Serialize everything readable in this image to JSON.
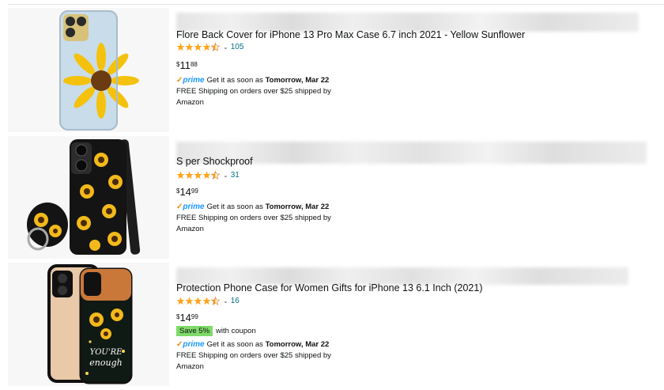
{
  "products": [
    {
      "title_visible": "Flore                  Back Cover for iPhone 13 Pro Max Case 6.7 inch 2021 - Yellow Sunflower",
      "rating_stars": 4.5,
      "review_count": "105",
      "price_symbol": "$",
      "price_whole": "11",
      "price_fraction": "88",
      "coupon": null,
      "prime_label": "prime",
      "delivery_text": "Get it as soon as",
      "delivery_date": "Tomorrow, Mar 22",
      "shipping_text": "FREE Shipping on orders over $25 shipped by",
      "shipped_by": "Amazon"
    },
    {
      "title_visible": "S                  per Shockproof",
      "rating_stars": 4.5,
      "review_count": "31",
      "price_symbol": "$",
      "price_whole": "14",
      "price_fraction": "99",
      "coupon": null,
      "prime_label": "prime",
      "delivery_text": "Get it as soon as",
      "delivery_date": "Tomorrow, Mar 22",
      "shipping_text": "FREE Shipping on orders over $25 shipped by",
      "shipped_by": "Amazon"
    },
    {
      "title_visible": "Protection Phone Case for Women Gifts for iPhone 13 6.1 Inch (2021)",
      "rating_stars": 4.5,
      "review_count": "16",
      "price_symbol": "$",
      "price_whole": "14",
      "price_fraction": "99",
      "coupon": {
        "badge": "Save 5%",
        "text": "with coupon"
      },
      "prime_label": "prime",
      "delivery_text": "Get it as soon as",
      "delivery_date": "Tomorrow, Mar 22",
      "shipping_text": "FREE Shipping on orders over $25 shipped by",
      "shipped_by": "Amazon"
    }
  ],
  "colors": {
    "star": "#ffa41c",
    "link": "#007185",
    "prime_blue": "#1a98ff",
    "prime_check": "#f08804",
    "coupon_badge": "#7fda69"
  }
}
